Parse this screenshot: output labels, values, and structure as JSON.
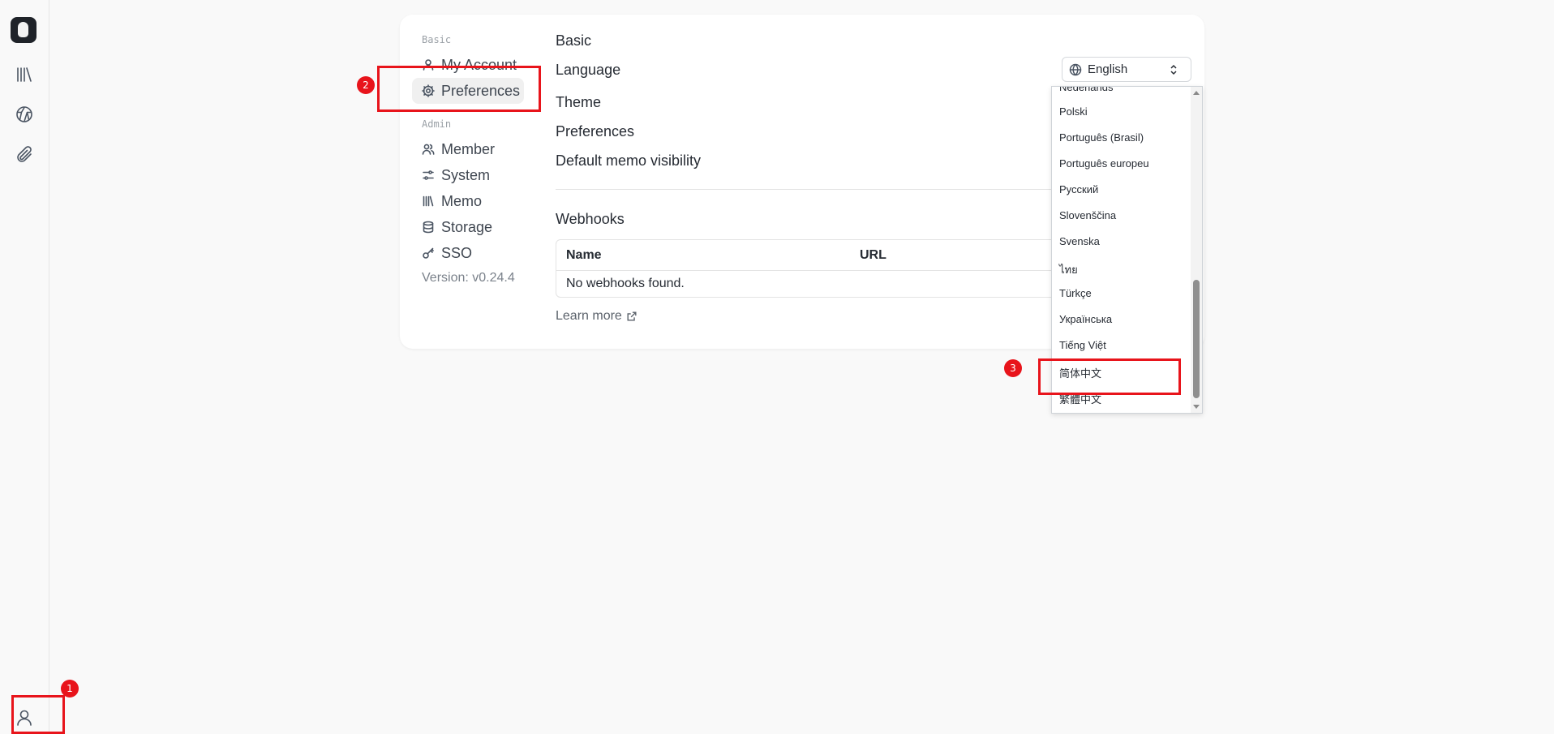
{
  "rail": {
    "items": [
      {
        "icon": "logo-icon"
      },
      {
        "icon": "library-icon"
      },
      {
        "icon": "explore-icon"
      },
      {
        "icon": "paperclip-icon"
      }
    ],
    "user_icon": "user-icon"
  },
  "sidebar": {
    "basic_label": "Basic",
    "admin_label": "Admin",
    "items": [
      {
        "label": "My Account",
        "icon": "user-icon"
      },
      {
        "label": "Preferences",
        "icon": "gear-icon",
        "active": true
      },
      {
        "label": "Member",
        "icon": "users-icon"
      },
      {
        "label": "System",
        "icon": "settings-icon"
      },
      {
        "label": "Memo",
        "icon": "library-icon"
      },
      {
        "label": "Storage",
        "icon": "database-icon"
      },
      {
        "label": "SSO",
        "icon": "key-icon"
      }
    ],
    "version": "Version: v0.24.4"
  },
  "main": {
    "heading": "Basic",
    "rows": {
      "language": "Language",
      "theme": "Theme",
      "preferences": "Preferences",
      "visibility": "Default memo visibility"
    },
    "language_select": {
      "value": "English",
      "icon": "globe-icon"
    },
    "webhooks": {
      "title": "Webhooks",
      "columns": [
        "Name",
        "URL"
      ],
      "empty": "No webhooks found."
    },
    "learn_more": "Learn more"
  },
  "dropdown": {
    "options": [
      "Nederlands",
      "Polski",
      "Português (Brasil)",
      "Português europeu",
      "Русский",
      "Slovenščina",
      "Svenska",
      "ไทย",
      "Türkçe",
      "Українська",
      "Tiếng Việt",
      "简体中文",
      "繁體中文"
    ]
  },
  "annotations": [
    "1",
    "2",
    "3"
  ],
  "colors": {
    "annotation": "#e8141b",
    "background": "#f9f9f9"
  }
}
